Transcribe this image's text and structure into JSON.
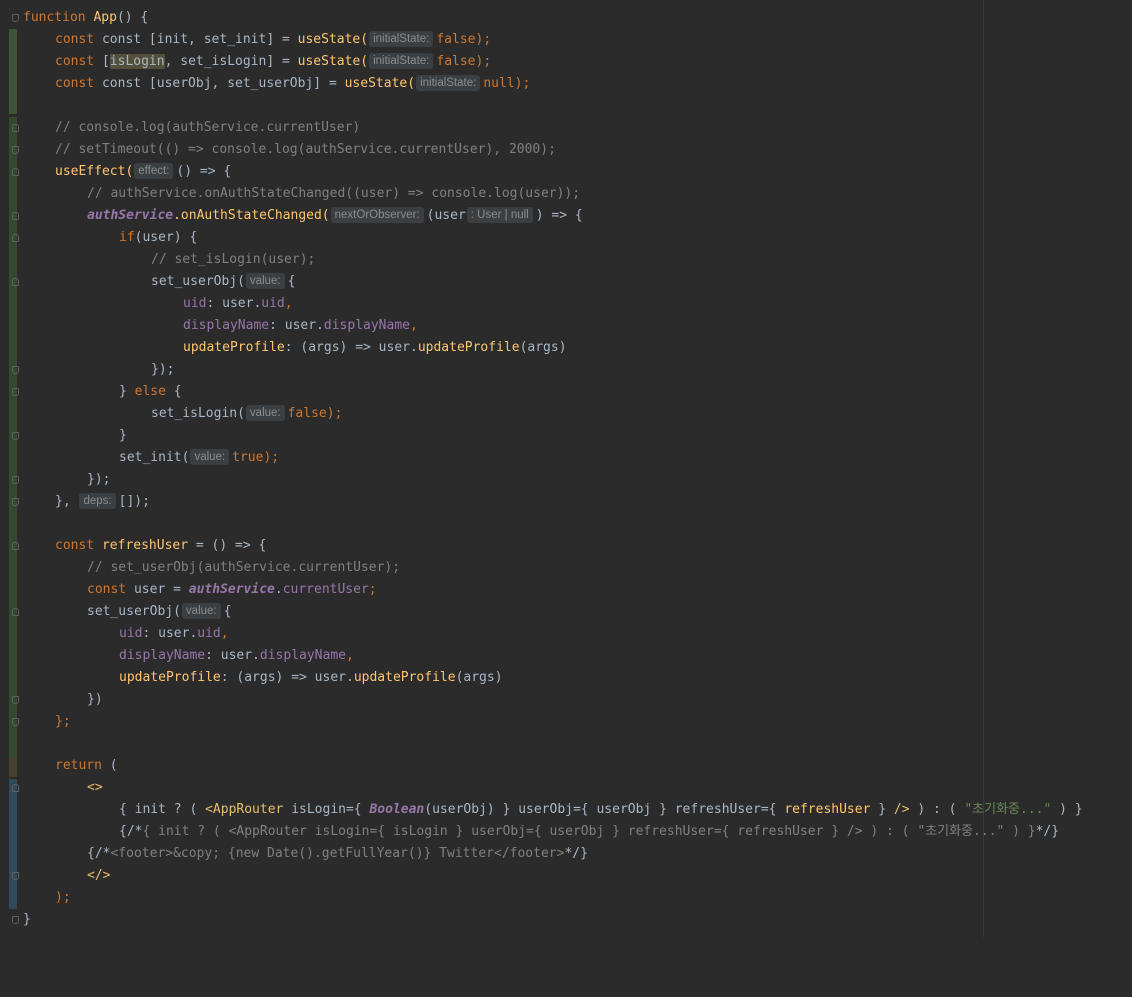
{
  "editor": {
    "language": "javascript",
    "hints": {
      "initial_state": "initialState:",
      "effect": "effect:",
      "next_or_observer": "nextOrObserver:",
      "user_type": ": User | null",
      "value": "value:",
      "deps": "deps:"
    },
    "lines": {
      "l1": "function App() {",
      "l2a": "const [init, set_init] = ",
      "l2b": "useState(",
      "l2c": "false",
      "l2d": ");",
      "l3a": "const [",
      "l3b": "isLogin",
      "l3c": ", set_isLogin] = ",
      "l3d": "useState(",
      "l3e": "false",
      "l3f": ");",
      "l4a": "const [userObj, set_userObj] = ",
      "l4b": "useState(",
      "l4c": "null",
      "l4d": ");",
      "l6": "// console.log(authService.currentUser)",
      "l7": "// setTimeout(() => console.log(authService.currentUser), 2000);",
      "l8a": "useEffect(",
      "l8b": "() => {",
      "l9": "// authService.onAuthStateChanged((user) => console.log(user));",
      "l10a": "authService",
      "l10b": ".onAuthStateChanged(",
      "l10c": "(user",
      "l10d": ") => {",
      "l11a": "if",
      "l11b": "(user) {",
      "l12": "// set_isLogin(user);",
      "l13a": "set_userObj(",
      "l13b": "{",
      "l14a": "uid",
      "l14b": ": user.",
      "l14c": "uid",
      "l14d": ",",
      "l15a": "displayName",
      "l15b": ": user.",
      "l15c": "displayName",
      "l15d": ",",
      "l16a": "updateProfile",
      "l16b": ": (args) => user.",
      "l16c": "updateProfile",
      "l16d": "(args)",
      "l17": "});",
      "l18a": "} ",
      "l18b": "else",
      "l18c": " {",
      "l19a": "set_isLogin(",
      "l19b": "false",
      "l19c": ");",
      "l20": "}",
      "l21a": "set_init(",
      "l21b": "true",
      "l21c": ");",
      "l22": "});",
      "l23a": "},",
      "l23b": "[]);",
      "l25a": "const ",
      "l25b": "refreshUser",
      "l25c": " = () => {",
      "l26": "// set_userObj(authService.currentUser);",
      "l27a": "const ",
      "l27b": "user = ",
      "l27c": "authService",
      "l27d": ".",
      "l27e": "currentUser",
      "l27f": ";",
      "l28a": "set_userObj(",
      "l28b": "{",
      "l29a": "uid",
      "l29b": ": user.",
      "l29c": "uid",
      "l29d": ",",
      "l30a": "displayName",
      "l30b": ": user.",
      "l30c": "displayName",
      "l30d": ",",
      "l31a": "updateProfile",
      "l31b": ": (args) => user.",
      "l31c": "updateProfile",
      "l31d": "(args)",
      "l32": "})",
      "l33": "};",
      "l35a": "return",
      "l35b": " (",
      "l36": "<>",
      "l37a": "{ init ? ( ",
      "l37b": "<AppRouter ",
      "l37c": "isLogin",
      "l37d": "={ ",
      "l37e": "Boolean",
      "l37f": "(userObj) } ",
      "l37g": "userObj",
      "l37h": "={ userObj } ",
      "l37i": "refreshUser",
      "l37j": "={ ",
      "l37k": "refreshUser",
      "l37l": " } ",
      "l37m": "/>",
      "l37n": " ) : ( ",
      "l37o": "\"초기화중...\"",
      "l37p": " ) }",
      "l38a": "{/*",
      "l38b": "{ init ? ( <AppRouter isLogin={ isLogin } userObj={ userObj } refreshUser={ refreshUser } /> ) : ( \"초기화중...\" ) }",
      "l38c": "*/}",
      "l39a": "{/*",
      "l39b": "<footer>&copy; {new Date().getFullYear()} Twitter</footer>",
      "l39c": "*/}",
      "l40": "</>",
      "l41": ");",
      "l42": "}"
    }
  }
}
